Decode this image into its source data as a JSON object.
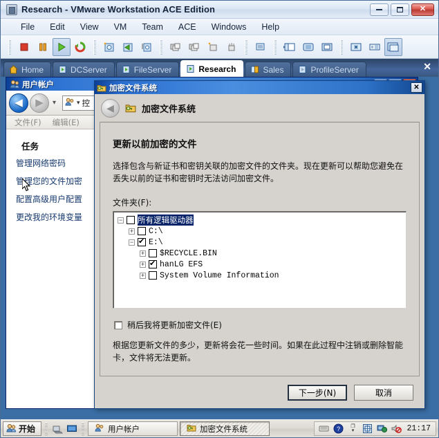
{
  "vmware": {
    "window_title": "Research - VMware Workstation ACE Edition",
    "app_icon": "vmware-icon",
    "window_buttons": {
      "minimize": "minimize-icon",
      "maximize": "maximize-icon",
      "close": "✕"
    },
    "menu": [
      "File",
      "Edit",
      "View",
      "VM",
      "Team",
      "ACE",
      "Windows",
      "Help"
    ],
    "toolbar": [
      {
        "name": "power-off-button",
        "icon": "stop-icon"
      },
      {
        "name": "suspend-button",
        "icon": "pause-icon"
      },
      {
        "name": "power-on-button",
        "icon": "play-icon",
        "pressed": true
      },
      {
        "name": "reset-button",
        "icon": "reset-icon"
      },
      {
        "name": "take-snapshot-button",
        "icon": "snapshot-add-icon"
      },
      {
        "name": "revert-snapshot-button",
        "icon": "snapshot-revert-icon"
      },
      {
        "name": "snapshot-manager-button",
        "icon": "snapshot-manager-icon"
      },
      {
        "name": "team-power-on-button",
        "icon": "team-icon"
      },
      {
        "name": "team-power-off-button",
        "icon": "team-icon"
      },
      {
        "name": "add-machine-button",
        "icon": "machine-add-icon"
      },
      {
        "name": "lan-segment-button",
        "icon": "lan-icon"
      },
      {
        "name": "capture-button",
        "icon": "capture-icon"
      },
      {
        "name": "show-sidebar-button",
        "icon": "sidebar-icon"
      },
      {
        "name": "quick-switch-button",
        "icon": "quick-switch-icon"
      },
      {
        "name": "full-screen-button",
        "icon": "fullscreen-icon"
      },
      {
        "name": "settings-button",
        "icon": "wrench-icon"
      },
      {
        "name": "summary-button",
        "icon": "summary-icon"
      },
      {
        "name": "console-view-button",
        "icon": "console-icon",
        "pressed": true
      }
    ],
    "tabs": [
      {
        "label": "Home",
        "icon": "home-icon",
        "active": false
      },
      {
        "label": "DCServer",
        "icon": "vm-icon",
        "active": false
      },
      {
        "label": "FileServer",
        "icon": "vm-icon",
        "active": false
      },
      {
        "label": "Research",
        "icon": "vm-icon",
        "active": true
      },
      {
        "label": "Sales",
        "icon": "team-icon",
        "active": false
      },
      {
        "label": "ProfileServer",
        "icon": "vm-icon",
        "active": false
      }
    ],
    "tabs_close_label": "✕"
  },
  "user_accounts_window": {
    "title": "用户帐户",
    "title_icon": "user-accounts-icon",
    "window_buttons": {
      "minimize": "_",
      "maximize": "❐",
      "close": "✕"
    },
    "nav": {
      "back": "◀",
      "forward": "▶",
      "dropdown": "▾"
    },
    "address_icon": "user-accounts-icon",
    "address_dropdown": "▾",
    "address_text": "控",
    "menu": [
      "文件(F)",
      "编辑(E)"
    ],
    "tasks_heading": "任务",
    "tasks": [
      "管理网络密码",
      "管理您的文件加密",
      "配置高级用户配置",
      "更改我的环境变量"
    ],
    "scroll_up": "▲",
    "scroll_down": "▼"
  },
  "efs_dialog": {
    "title": "加密文件系统",
    "title_icon": "efs-folder-key-icon",
    "close_label": "✕",
    "header_back": "◀",
    "header_icon": "efs-folder-key-icon",
    "header_text": "加密文件系统",
    "heading": "更新以前加密的文件",
    "description": "选择包含与新证书和密钥关联的加密文件的文件夹。现在更新可以帮助您避免在丢失以前的证书和密钥时无法访问加密文件。",
    "folder_label": "文件夹(F):",
    "tree": [
      {
        "level": 0,
        "expander": "−",
        "checked": false,
        "label": "所有逻辑驱动器",
        "selected": true
      },
      {
        "level": 1,
        "expander": "+",
        "checked": false,
        "label": "C:\\",
        "selected": false
      },
      {
        "level": 1,
        "expander": "−",
        "checked": true,
        "label": "E:\\",
        "selected": false
      },
      {
        "level": 2,
        "expander": "+",
        "checked": false,
        "label": "$RECYCLE.BIN",
        "selected": false
      },
      {
        "level": 2,
        "expander": "+",
        "checked": true,
        "label": "hanLG EFS",
        "selected": false
      },
      {
        "level": 2,
        "expander": "+",
        "checked": false,
        "label": "System Volume Information",
        "selected": false
      }
    ],
    "later_checkbox_label": "稍后我将更新加密文件(E)",
    "later_checkbox_checked": false,
    "footer_note": "根据您更新文件的多少，更新将会花一些时间。如果在此过程中注销或删除智能卡，文件将无法更新。",
    "next_button": "下一步(N)",
    "cancel_button": "取消"
  },
  "taskbar": {
    "start_label": "开始",
    "start_icon": "windows-start-icon",
    "quick_launch": [
      {
        "name": "show-desktop-icon",
        "icon": "desktop-icon"
      },
      {
        "name": "display-icon",
        "icon": "monitor-icon"
      }
    ],
    "items": [
      {
        "label": "用户帐户",
        "icon": "user-accounts-icon",
        "active": false
      },
      {
        "label": "加密文件系统",
        "icon": "efs-folder-key-icon",
        "active": true
      }
    ],
    "tray": [
      {
        "name": "keyboard-layout-icon",
        "glyph": "⌨"
      },
      {
        "name": "help-icon",
        "glyph": "?"
      },
      {
        "name": "expand-tray-icon",
        "glyph": "▾"
      },
      {
        "name": "vmware-tools-icon",
        "glyph": "◫"
      },
      {
        "name": "network-icon",
        "glyph": "🖧"
      },
      {
        "name": "volume-muted-icon",
        "glyph": "🔇"
      }
    ],
    "clock": "21:17"
  },
  "colors": {
    "vm_titlebar": "#dce7f5",
    "vm_tabs_bg": "#44659a",
    "dialog_face": "#d6d3ce",
    "dialog_titlebar": "#2a6fd0",
    "selection": "#0a246a",
    "link": "#16396e",
    "play_green": "#4caf2a",
    "stop_red": "#d93b2b"
  }
}
